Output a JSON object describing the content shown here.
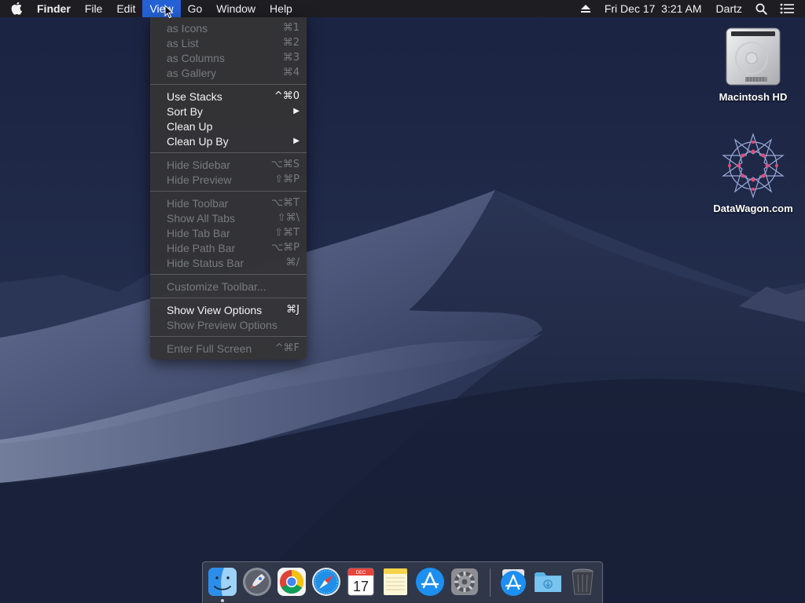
{
  "menubar": {
    "app_name": "Finder",
    "menus": [
      "File",
      "Edit",
      "View",
      "Go",
      "Window",
      "Help"
    ],
    "active_menu": "View",
    "clock": "Fri Dec 17  3:21 AM",
    "user": "Dartz"
  },
  "view_menu": {
    "items": [
      {
        "label": "as Icons",
        "shortcut": "⌘1",
        "enabled": false
      },
      {
        "label": "as List",
        "shortcut": "⌘2",
        "enabled": false
      },
      {
        "label": "as Columns",
        "shortcut": "⌘3",
        "enabled": false
      },
      {
        "label": "as Gallery",
        "shortcut": "⌘4",
        "enabled": false
      },
      {
        "label": "Use Stacks",
        "shortcut": "^⌘0",
        "enabled": true
      },
      {
        "label": "Sort By",
        "shortcut": "▶",
        "enabled": true
      },
      {
        "label": "Clean Up",
        "shortcut": "",
        "enabled": true
      },
      {
        "label": "Clean Up By",
        "shortcut": "▶",
        "enabled": true
      },
      {
        "label": "Hide Sidebar",
        "shortcut": "⌥⌘S",
        "enabled": false
      },
      {
        "label": "Hide Preview",
        "shortcut": "⇧⌘P",
        "enabled": false
      },
      {
        "label": "Hide Toolbar",
        "shortcut": "⌥⌘T",
        "enabled": false
      },
      {
        "label": "Show All Tabs",
        "shortcut": "⇧⌘\\",
        "enabled": false
      },
      {
        "label": "Hide Tab Bar",
        "shortcut": "⇧⌘T",
        "enabled": false
      },
      {
        "label": "Hide Path Bar",
        "shortcut": "⌥⌘P",
        "enabled": false
      },
      {
        "label": "Hide Status Bar",
        "shortcut": "⌘/",
        "enabled": false
      },
      {
        "label": "Customize Toolbar...",
        "shortcut": "",
        "enabled": false
      },
      {
        "label": "Show View Options",
        "shortcut": "⌘J",
        "enabled": true
      },
      {
        "label": "Show Preview Options",
        "shortcut": "",
        "enabled": false
      },
      {
        "label": "Enter Full Screen",
        "shortcut": "^⌘F",
        "enabled": false
      }
    ]
  },
  "desktop": {
    "icons": [
      {
        "label": "Macintosh HD",
        "icon": "hard-drive-icon"
      },
      {
        "label": "DataWagon.com",
        "icon": "star-pattern-icon"
      }
    ]
  },
  "dock": {
    "apps": [
      {
        "name": "finder",
        "icon": "finder-icon",
        "running": true
      },
      {
        "name": "launchpad",
        "icon": "launchpad-icon",
        "running": false
      },
      {
        "name": "chrome",
        "icon": "chrome-icon",
        "running": false
      },
      {
        "name": "safari",
        "icon": "safari-icon",
        "running": false
      },
      {
        "name": "calendar",
        "icon": "calendar-icon",
        "running": false,
        "month": "DEC",
        "day": "17"
      },
      {
        "name": "notes",
        "icon": "notes-icon",
        "running": false
      },
      {
        "name": "app-store",
        "icon": "app-store-icon",
        "running": false
      },
      {
        "name": "system-preferences",
        "icon": "gear-icon",
        "running": false
      },
      {
        "name": "applications-folder",
        "icon": "app-store-icon",
        "running": false
      },
      {
        "name": "downloads-folder",
        "icon": "folder-icon",
        "running": false
      },
      {
        "name": "trash",
        "icon": "trash-icon",
        "running": false
      }
    ]
  },
  "colors": {
    "menu_highlight": "#2461d4",
    "menu_bg": "#343436",
    "disabled_text": "#777a7e"
  }
}
